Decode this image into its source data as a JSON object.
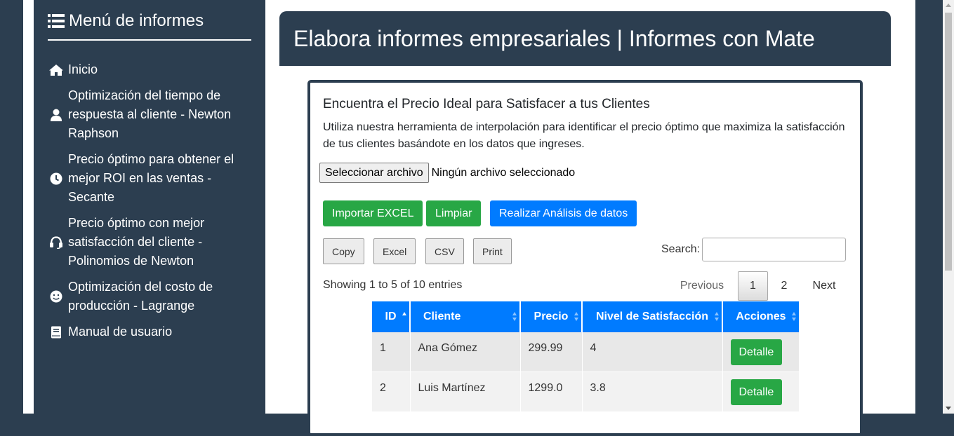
{
  "sidebar": {
    "title": "Menú de informes",
    "items": [
      {
        "label": "Inicio",
        "icon": "home-icon"
      },
      {
        "label": "Optimización del tiempo de respuesta al cliente - Newton Raphson",
        "icon": "user-icon"
      },
      {
        "label": "Precio óptimo para obtener el mejor ROI en las ventas - Secante",
        "icon": "clock-icon"
      },
      {
        "label": "Precio óptimo con mejor satisfacción del cliente - Polinomios de Newton",
        "icon": "headset-icon"
      },
      {
        "label": "Optimización del costo de producción - Lagrange",
        "icon": "smile-icon"
      },
      {
        "label": "Manual de usuario",
        "icon": "book-icon"
      }
    ]
  },
  "header": {
    "title": "Elabora informes empresariales | Informes con Mate"
  },
  "card": {
    "title": "Encuentra el Precio Ideal para Satisfacer a tus Clientes",
    "description": "Utiliza nuestra herramienta de interpolación para identificar el precio óptimo que maximiza la satisfacción de tus clientes basándote en los datos que ingreses.",
    "file": {
      "button": "Seleccionar archivo",
      "status": "Ningún archivo seleccionado"
    },
    "actions": {
      "import": "Importar EXCEL",
      "clear": "Limpiar",
      "analyze": "Realizar Análisis de datos"
    },
    "export_buttons": {
      "copy": "Copy",
      "excel": "Excel",
      "csv": "CSV",
      "print": "Print"
    },
    "search": {
      "label": "Search:",
      "value": ""
    },
    "info": "Showing 1 to 5 of 10 entries",
    "pagination": {
      "previous": "Previous",
      "pages": [
        "1",
        "2"
      ],
      "current": "1",
      "next": "Next"
    },
    "table": {
      "columns": [
        "ID",
        "Cliente",
        "Precio",
        "Nivel de Satisfacción",
        "Acciones"
      ],
      "sorted_column": "ID",
      "rows": [
        {
          "id": "1",
          "cliente": "Ana Gómez",
          "precio": "299.99",
          "nivel": "4",
          "accion": "Detalle"
        },
        {
          "id": "2",
          "cliente": "Luis Martínez",
          "precio": "1299.0",
          "nivel": "3.8",
          "accion": "Detalle"
        }
      ]
    }
  },
  "colors": {
    "navy": "#2c3e50",
    "primary": "#007bff",
    "success": "#28a745"
  }
}
